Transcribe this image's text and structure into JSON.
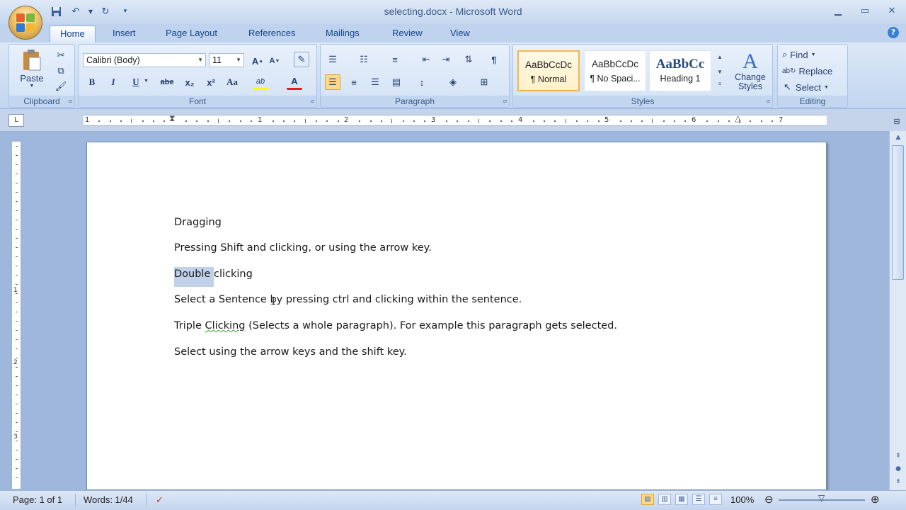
{
  "window": {
    "title": "selecting.docx - Microsoft Word"
  },
  "qat": {
    "save_icon": "save-icon",
    "undo_icon": "undo-icon",
    "redo_icon": "redo-icon"
  },
  "tabs": [
    "Home",
    "Insert",
    "Page Layout",
    "References",
    "Mailings",
    "Review",
    "View"
  ],
  "clipboard": {
    "paste": "Paste",
    "label": "Clipboard"
  },
  "font": {
    "name": "Calibri (Body)",
    "size": "11",
    "label": "Font",
    "bold": "B",
    "italic": "I",
    "underline": "U",
    "strike": "abe",
    "subscript": "x₂",
    "superscript": "x²",
    "change_case": "Aa",
    "font_color": "A",
    "highlight": "ab"
  },
  "paragraph": {
    "label": "Paragraph",
    "pilcrow": "¶"
  },
  "styles": {
    "label": "Styles",
    "tiles": [
      {
        "sample": "AaBbCcDc",
        "name": "¶ Normal"
      },
      {
        "sample": "AaBbCcDc",
        "name": "¶ No Spaci..."
      },
      {
        "sample": "AaBbCc",
        "name": "Heading 1"
      }
    ],
    "change_styles": "Change Styles"
  },
  "editing": {
    "label": "Editing",
    "find": "Find",
    "replace": "Replace",
    "select": "Select"
  },
  "ruler": {
    "numbers": [
      "1",
      "1",
      "2",
      "3",
      "4",
      "5",
      "6",
      "7"
    ]
  },
  "vruler": {
    "numbers": [
      "1",
      "1",
      "2",
      "3"
    ]
  },
  "document": {
    "p1": "Dragging",
    "p2": "Pressing Shift and clicking, or using the arrow key.",
    "p3_selected": "Double ",
    "p3_rest": "clicking",
    "p4": "Select a Sentence by pressing ctrl and clicking within the sentence.",
    "p5_a": "Triple ",
    "p5_b": "Clicking",
    "p5_c": "  (Selects a whole paragraph). For example this paragraph gets selected.",
    "p6": "Select using the arrow keys and the shift key."
  },
  "status": {
    "page": "Page: 1 of 1",
    "words": "Words: 1/44",
    "zoom": "100%"
  },
  "colors": {
    "ribbon": "#c9dbf2",
    "highlight": "#c1d1ea",
    "accent": "#15428b"
  }
}
